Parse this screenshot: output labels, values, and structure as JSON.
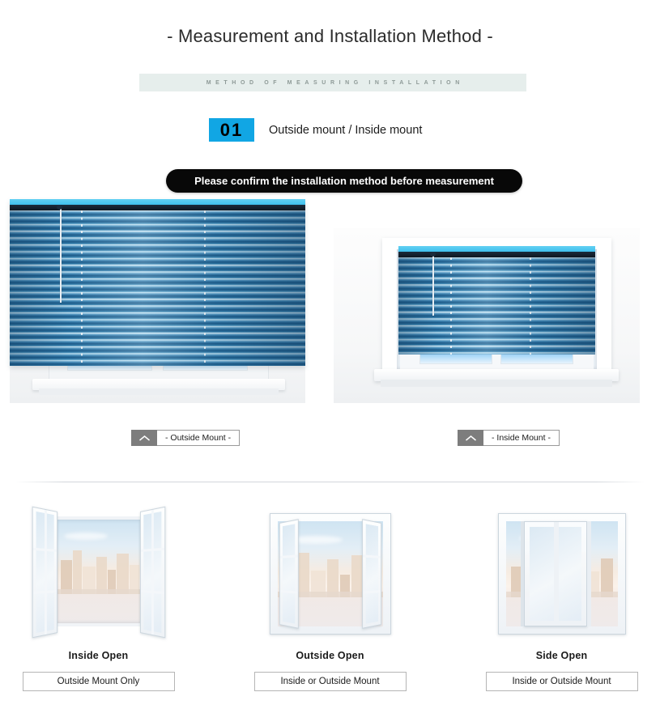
{
  "page": {
    "title": "- Measurement and Installation Method -",
    "subtitle_band": "METHOD OF MEASURING INSTALLATION"
  },
  "step": {
    "number": "01",
    "label": "Outside mount / Inside mount",
    "badge_color": "#11a6e4"
  },
  "notice": {
    "text": "Please confirm the installation method before measurement",
    "background": "#080808",
    "text_color": "#ffffff"
  },
  "mount_examples": [
    {
      "id": "outside-mount",
      "caption": "- Outside Mount -",
      "chevron_icon": "chevron-up-icon"
    },
    {
      "id": "inside-mount",
      "caption": "- Inside Mount -",
      "chevron_icon": "chevron-up-icon"
    }
  ],
  "window_types": [
    {
      "id": "inside-open",
      "title": "Inside Open",
      "tag": "Outside Mount Only"
    },
    {
      "id": "outside-open",
      "title": "Outside Open",
      "tag": "Inside or Outside Mount"
    },
    {
      "id": "side-open",
      "title": "Side Open",
      "tag": "Inside or Outside Mount"
    }
  ]
}
